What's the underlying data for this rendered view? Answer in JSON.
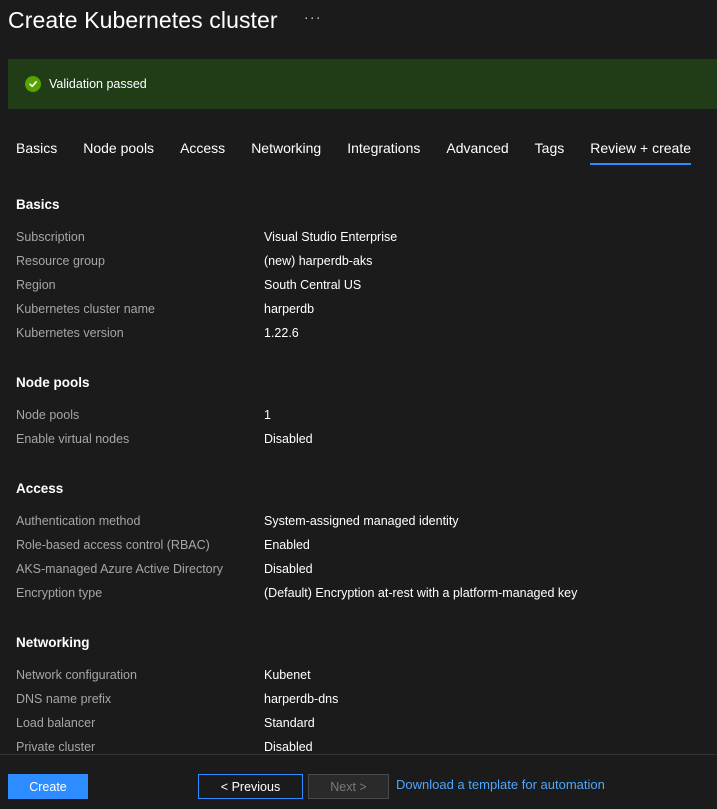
{
  "header": {
    "title": "Create Kubernetes cluster",
    "more_label": "···"
  },
  "banner": {
    "text": "Validation passed",
    "icon": "check-circle-icon",
    "color": "#57a300"
  },
  "tabs": [
    {
      "label": "Basics"
    },
    {
      "label": "Node pools"
    },
    {
      "label": "Access"
    },
    {
      "label": "Networking"
    },
    {
      "label": "Integrations"
    },
    {
      "label": "Advanced"
    },
    {
      "label": "Tags"
    },
    {
      "label": "Review + create",
      "active": true
    }
  ],
  "sections": {
    "basics": {
      "title": "Basics",
      "rows": [
        {
          "label": "Subscription",
          "value": "Visual Studio Enterprise"
        },
        {
          "label": "Resource group",
          "value": "(new) harperdb-aks"
        },
        {
          "label": "Region",
          "value": "South Central US"
        },
        {
          "label": "Kubernetes cluster name",
          "value": "harperdb"
        },
        {
          "label": "Kubernetes version",
          "value": "1.22.6"
        }
      ]
    },
    "node_pools": {
      "title": "Node pools",
      "rows": [
        {
          "label": "Node pools",
          "value": "1"
        },
        {
          "label": "Enable virtual nodes",
          "value": "Disabled"
        }
      ]
    },
    "access": {
      "title": "Access",
      "rows": [
        {
          "label": "Authentication method",
          "value": "System-assigned managed identity"
        },
        {
          "label": "Role-based access control (RBAC)",
          "value": "Enabled"
        },
        {
          "label": "AKS-managed Azure Active Directory",
          "value": "Disabled"
        },
        {
          "label": "Encryption type",
          "value": "(Default) Encryption at-rest with a platform-managed key"
        }
      ]
    },
    "networking": {
      "title": "Networking",
      "rows": [
        {
          "label": "Network configuration",
          "value": "Kubenet"
        },
        {
          "label": "DNS name prefix",
          "value": "harperdb-dns"
        },
        {
          "label": "Load balancer",
          "value": "Standard"
        },
        {
          "label": "Private cluster",
          "value": "Disabled"
        }
      ]
    }
  },
  "footer": {
    "create_label": "Create",
    "previous_label": "< Previous",
    "next_label": "Next >",
    "download_label": "Download a template for automation"
  },
  "colors": {
    "accent": "#2d8cff",
    "banner_bg": "#203d18",
    "background": "#1b1b1b"
  }
}
